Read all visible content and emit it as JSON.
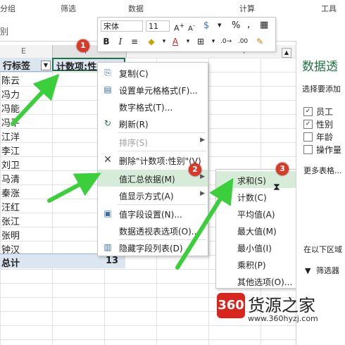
{
  "ribbon": {
    "groups": [
      "分组",
      "筛选",
      "数据",
      "计算",
      "工具"
    ]
  },
  "formula": {
    "name_box": "别"
  },
  "columns": [
    "E",
    "F",
    "I"
  ],
  "pivot": {
    "row_header": "行标签",
    "value_header": "计数项:性别",
    "rows": [
      "陈云",
      "冯力",
      "冯能",
      "冯平",
      "江洋",
      "李江",
      "刘卫",
      "马清",
      "秦涨",
      "汪红",
      "张江",
      "张明",
      "钟汉"
    ],
    "total_label": "总计",
    "total_value": "13"
  },
  "mini_toolbar": {
    "font_name": "宋体",
    "font_size": "11",
    "bold": "B",
    "italic": "I",
    "percent": "%",
    "comma": ","
  },
  "context_menu": {
    "items": [
      "复制(C)",
      "设置单元格格式(F)...",
      "数字格式(T)...",
      "刷新(R)",
      "排序(S)",
      "删除\"计数项:性别\"(V)",
      "值汇总依据(M)",
      "值显示方式(A)",
      "值字段设置(N)...",
      "数据透视表选项(O)...",
      "隐藏字段列表(D)"
    ]
  },
  "submenu": {
    "items": [
      "求和(S)",
      "计数(C)",
      "平均值(A)",
      "最大值(M)",
      "最小值(I)",
      "乘积(P)",
      "其他选项(O)..."
    ]
  },
  "pane": {
    "title": "数据透",
    "subtitle": "选择要添加",
    "fields": [
      {
        "label": "员工",
        "checked": true
      },
      {
        "label": "性别",
        "checked": true
      },
      {
        "label": "年龄",
        "checked": false
      },
      {
        "label": "操作量",
        "checked": false
      }
    ],
    "more_tables": "更多表格...",
    "area_hint": "在以下区域",
    "filter_label": "筛选器"
  },
  "badges": [
    "1",
    "2",
    "3"
  ],
  "watermark": {
    "logo": "360",
    "name": "货源之家",
    "url": "www.360hyzj.com"
  },
  "colors": {
    "accent": "#217346",
    "badge": "#d83a2a",
    "arrow": "#3ccf3c",
    "highlight": "#d6ecd9"
  }
}
